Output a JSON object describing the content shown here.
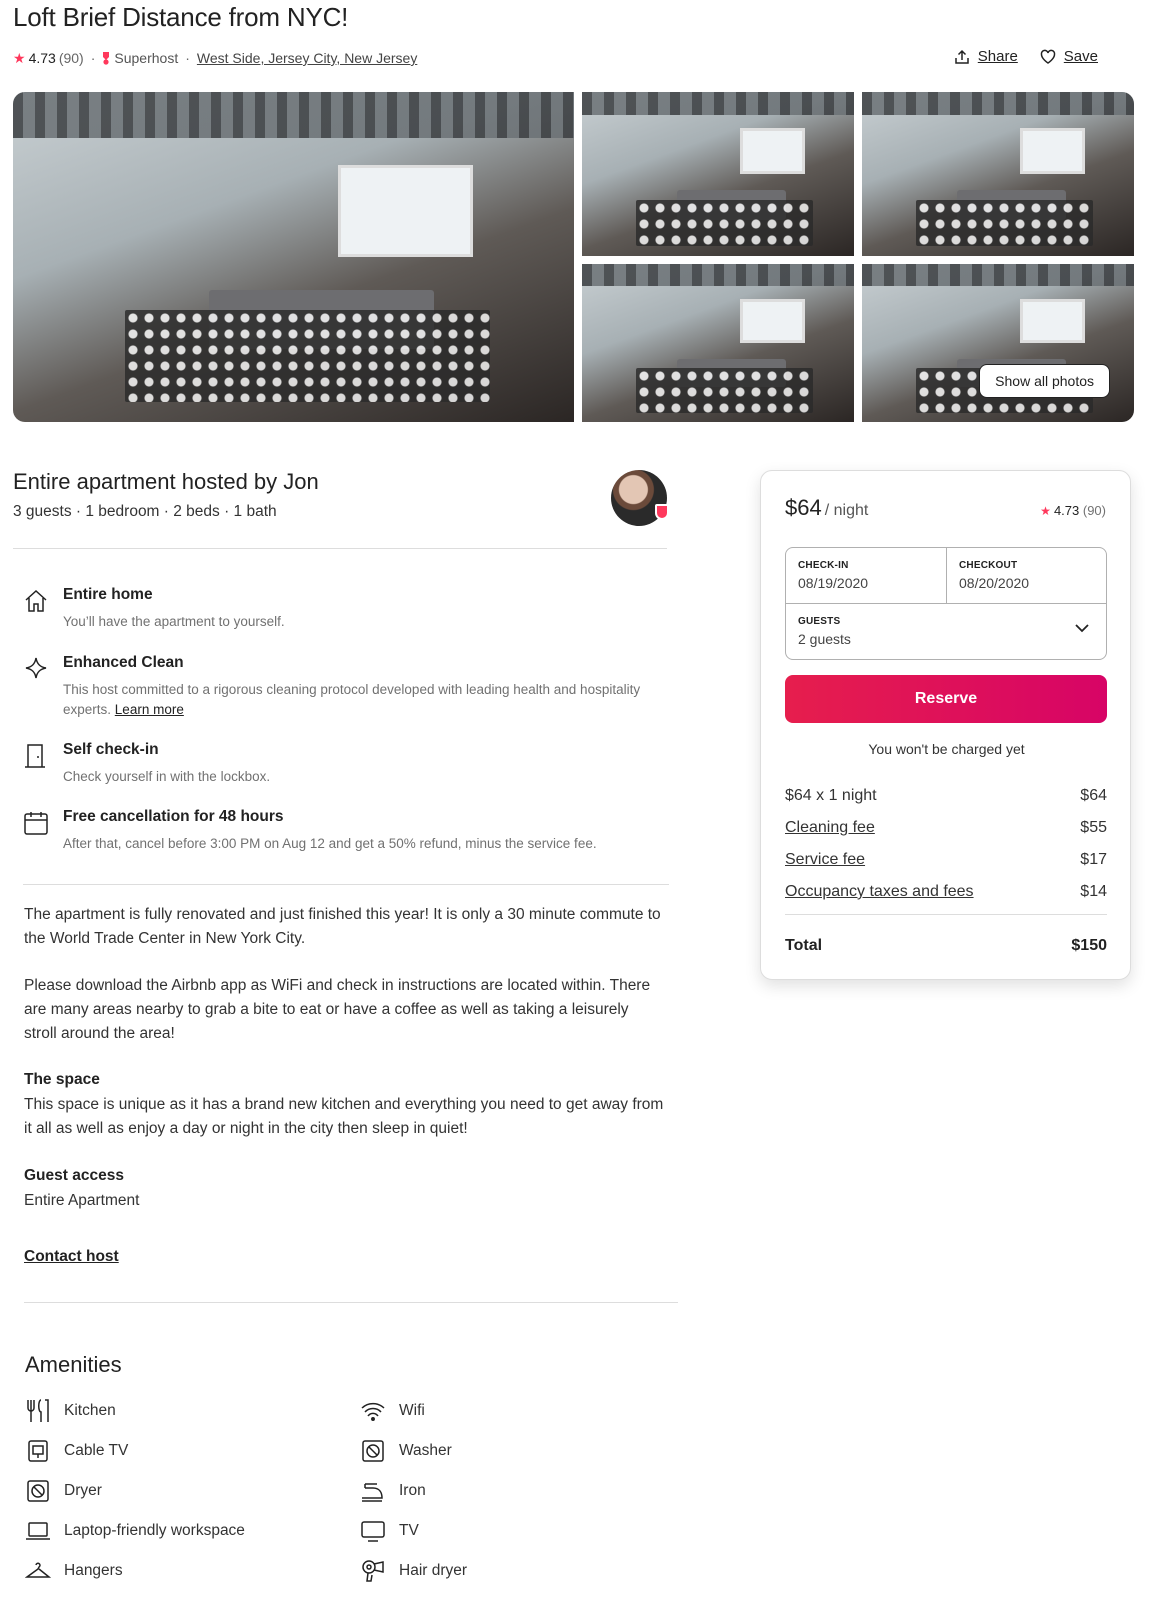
{
  "listing": {
    "title": "Loft Brief Distance from NYC!",
    "rating": "4.73",
    "reviews": "(90)",
    "superhost": "Superhost",
    "location": "West Side, Jersey City, New Jersey",
    "share": "Share",
    "save": "Save"
  },
  "gallery": {
    "show_all": "Show all photos"
  },
  "host": {
    "title": "Entire apartment hosted by Jon",
    "summary": "3 guests · 1 bedroom · 2 beds · 1 bath"
  },
  "features": [
    {
      "icon": "home-icon",
      "title": "Entire home",
      "desc": "You’ll have the apartment to yourself."
    },
    {
      "icon": "sparkle-icon",
      "title": "Enhanced Clean",
      "desc": "This host committed to a rigorous cleaning protocol developed with leading health and hospitality experts.",
      "link": "Learn more"
    },
    {
      "icon": "door-icon",
      "title": "Self check-in",
      "desc": "Check yourself in with the lockbox."
    },
    {
      "icon": "calendar-icon",
      "title": "Free cancellation for 48 hours",
      "desc": "After that, cancel before 3:00 PM on Aug 12 and get a 50% refund, minus the service fee."
    }
  ],
  "description": {
    "p1": "The apartment is fully renovated and just finished this year! It is only a 30 minute commute to the World Trade Center in New York City.",
    "p2": "Please download the Airbnb app as WiFi and check in instructions are located within. There are many areas nearby to grab a bite to eat or have a coffee as well as taking a leisurely stroll around the area!",
    "space_title": "The space",
    "space_text": "This space is unique as it has a brand new kitchen and everything you need to get away from it all as well as enjoy a day or night in the city then sleep in quiet!",
    "access_title": "Guest access",
    "access_text": "Entire Apartment",
    "contact": "Contact host"
  },
  "amenities": {
    "title": "Amenities",
    "items": [
      {
        "label": "Kitchen",
        "icon": "kitchen-icon"
      },
      {
        "label": "Wifi",
        "icon": "wifi-icon"
      },
      {
        "label": "Cable TV",
        "icon": "cable-tv-icon"
      },
      {
        "label": "Washer",
        "icon": "washer-icon"
      },
      {
        "label": "Dryer",
        "icon": "dryer-icon"
      },
      {
        "label": "Iron",
        "icon": "iron-icon"
      },
      {
        "label": "Laptop-friendly workspace",
        "icon": "laptop-icon"
      },
      {
        "label": "TV",
        "icon": "tv-icon"
      },
      {
        "label": "Hangers",
        "icon": "hanger-icon"
      },
      {
        "label": "Hair dryer",
        "icon": "hair-dryer-icon"
      }
    ]
  },
  "booking": {
    "price": "$64",
    "per_night": "/ night",
    "rating": "4.73",
    "reviews": "(90)",
    "checkin_label": "CHECK-IN",
    "checkin": "08/19/2020",
    "checkout_label": "CHECKOUT",
    "checkout": "08/20/2020",
    "guests_label": "GUESTS",
    "guests": "2 guests",
    "reserve": "Reserve",
    "note": "You won't be charged yet",
    "lines": [
      {
        "label": "$64 x 1 night",
        "value": "$64"
      },
      {
        "label": "Cleaning fee",
        "value": "$55"
      },
      {
        "label": "Service fee",
        "value": "$17"
      },
      {
        "label": "Occupancy taxes and fees",
        "value": "$14"
      }
    ],
    "total_label": "Total",
    "total": "$150"
  },
  "colors": {
    "brand": "#ff385c",
    "reserve_start": "#e61e4d",
    "reserve_end": "#d70466"
  }
}
